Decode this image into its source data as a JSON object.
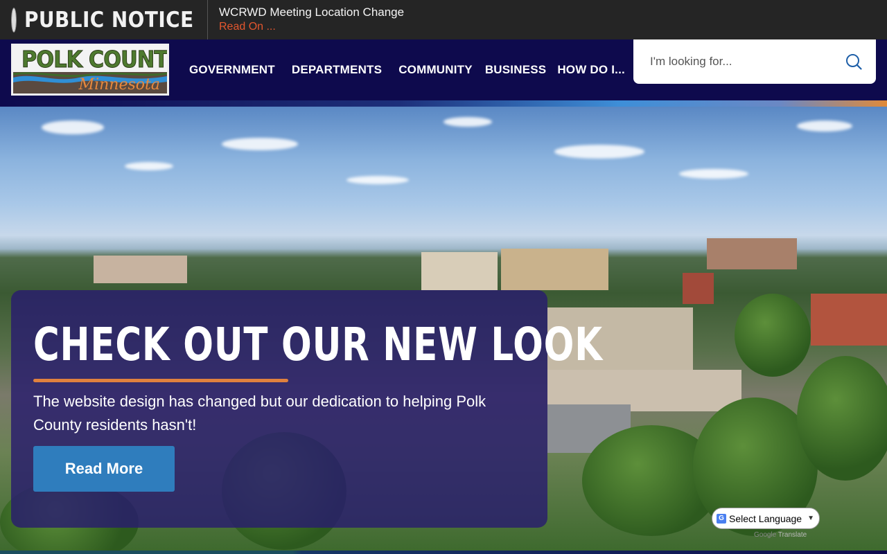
{
  "notice": {
    "title": "PUBLIC NOTICE",
    "headline": "WCRWD Meeting Location Change",
    "link": "Read On ..."
  },
  "logo": {
    "name": "POLK COUNTY",
    "state": "Minnesota"
  },
  "nav": {
    "items": [
      "GOVERNMENT",
      "DEPARTMENTS",
      "COMMUNITY",
      "BUSINESS",
      "HOW DO I..."
    ]
  },
  "search": {
    "placeholder": "I'm looking for..."
  },
  "hero": {
    "title": "CHECK OUT OUR NEW LOOK",
    "text": "The website design has changed but our dedication to helping Polk County residents hasn't!",
    "button": "Read More"
  },
  "translate": {
    "label": "Select Language",
    "powered_by": "Google",
    "powered_suffix": "Translate"
  },
  "colors": {
    "header": "#0e0a4d",
    "notice_bg": "#252525",
    "accent_orange": "#e0813e",
    "link_red": "#e4572e",
    "button_blue": "#2f7dbd"
  }
}
